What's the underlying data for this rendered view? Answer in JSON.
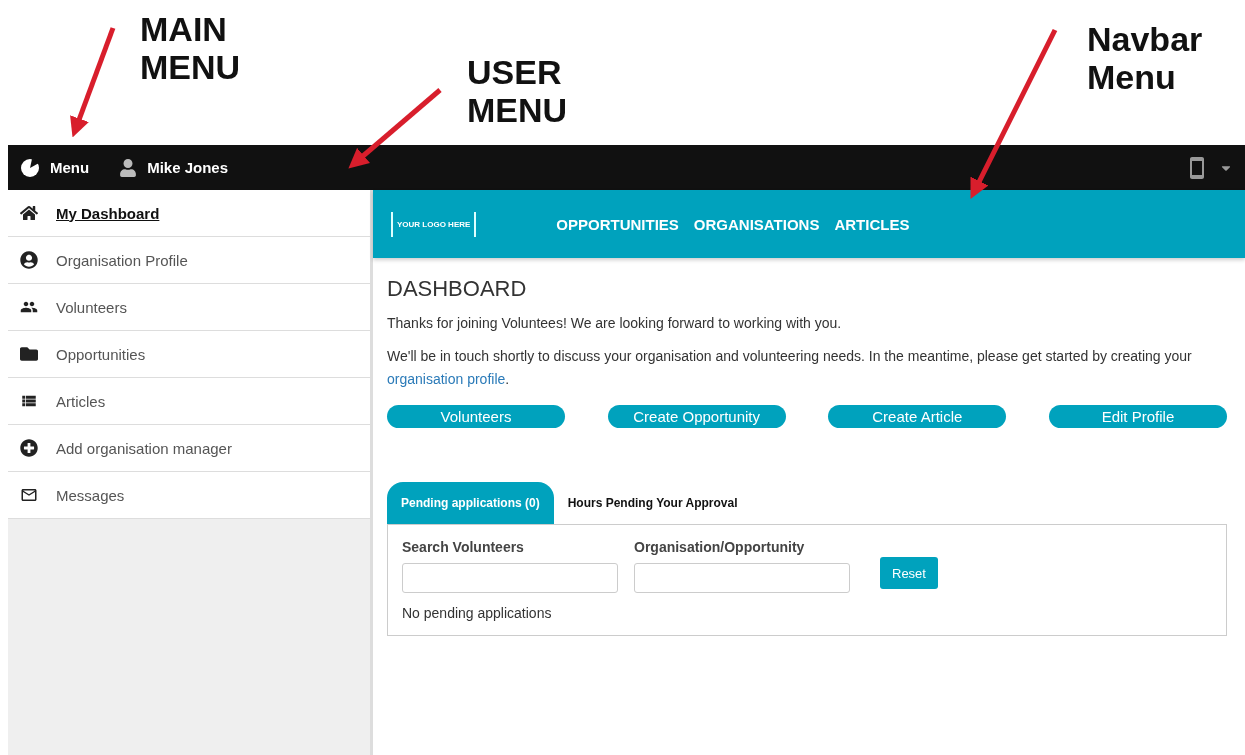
{
  "annotations": [
    {
      "lines": [
        "MAIN",
        "MENU"
      ]
    },
    {
      "lines": [
        "USER",
        "MENU"
      ]
    },
    {
      "lines": [
        "Navbar",
        "Menu"
      ]
    }
  ],
  "topbar": {
    "menu_label": "Menu",
    "user_name": "Mike Jones"
  },
  "sidebar": {
    "items": [
      {
        "label": "My Dashboard",
        "selected": true
      },
      {
        "label": "Organisation Profile",
        "selected": false
      },
      {
        "label": "Volunteers",
        "selected": false
      },
      {
        "label": "Opportunities",
        "selected": false
      },
      {
        "label": "Articles",
        "selected": false
      },
      {
        "label": "Add organisation manager",
        "selected": false
      },
      {
        "label": "Messages",
        "selected": false
      }
    ]
  },
  "navbar": {
    "logo": "YOUR LOGO HERE",
    "links": [
      "OPPORTUNITIES",
      "ORGANISATIONS",
      "ARTICLES"
    ]
  },
  "main": {
    "title": "DASHBOARD",
    "intro": "Thanks for joining Voluntees! We are looking forward to working with you.",
    "note": "We'll be in touch shortly to discuss your organisation and volunteering needs. In the meantime, please get started by creating your",
    "note_link": "organisation profile",
    "note_end": ".",
    "buttons": [
      "Volunteers",
      "Create Opportunity",
      "Create Article",
      "Edit Profile"
    ],
    "tabs": [
      {
        "label": "Pending applications (0)",
        "selected": true
      },
      {
        "label": "Hours Pending Your Approval",
        "selected": false
      }
    ],
    "filters": [
      {
        "label": "Search Volunteers"
      },
      {
        "label": "Organisation/Opportunity"
      }
    ],
    "reset": "Reset",
    "empty": "No pending applications"
  }
}
